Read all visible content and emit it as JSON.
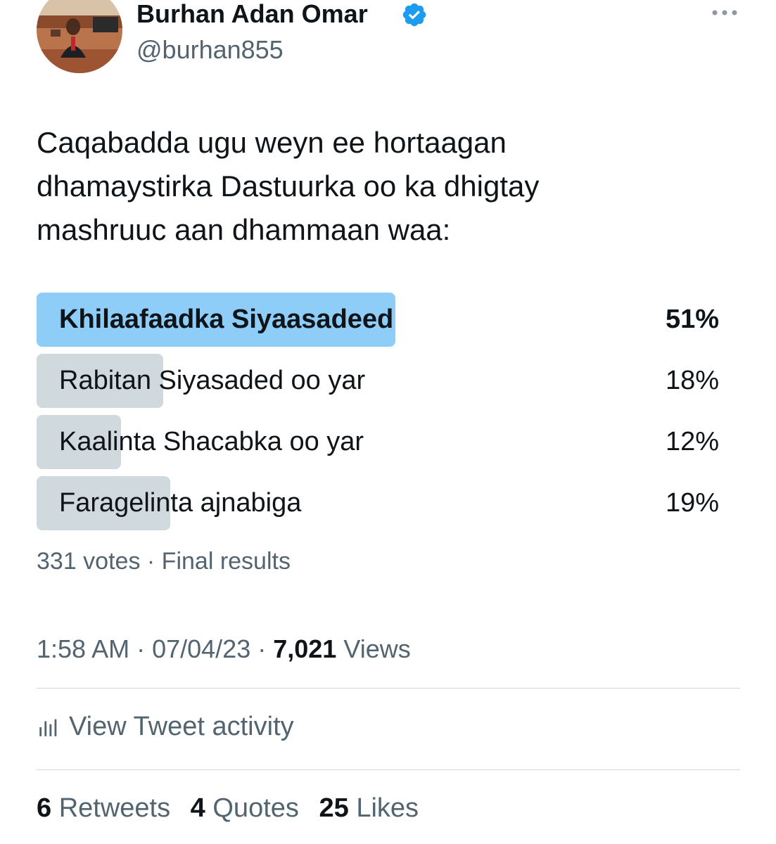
{
  "author": {
    "name": "Burhan Adan Omar",
    "handle": "@burhan855",
    "verified_color": "#1d9bf0"
  },
  "tweet": {
    "text": "Caqabadda ugu weyn ee  hortaagan\ndhamaystirka Dastuurka oo ka dhigtay\nmashruuc aan dhammaan waa:"
  },
  "poll": {
    "options": [
      {
        "label": "Khilaafaadka Siyaasadeed",
        "percent_text": "51%",
        "percent": 51,
        "winner": true
      },
      {
        "label": "Rabitan Siyasaded oo yar",
        "percent_text": "18%",
        "percent": 18,
        "winner": false
      },
      {
        "label": "Kaalinta Shacabka oo yar",
        "percent_text": "12%",
        "percent": 12,
        "winner": false
      },
      {
        "label": "Faragelinta ajnabiga",
        "percent_text": "19%",
        "percent": 19,
        "winner": false
      }
    ],
    "votes": "331 votes",
    "separator": " · ",
    "status": "Final results",
    "colors": {
      "winner": "#8ecdf8",
      "other": "#cfd9de"
    }
  },
  "meta": {
    "time": "1:58 AM",
    "date": "07/04/23",
    "views_count": "7,021",
    "views_label": "Views"
  },
  "activity": {
    "label": "View Tweet activity",
    "icon": "analytics-bar-icon"
  },
  "stats": {
    "retweets_count": "6",
    "retweets_label": "Retweets",
    "quotes_count": "4",
    "quotes_label": "Quotes",
    "likes_count": "25",
    "likes_label": "Likes"
  }
}
